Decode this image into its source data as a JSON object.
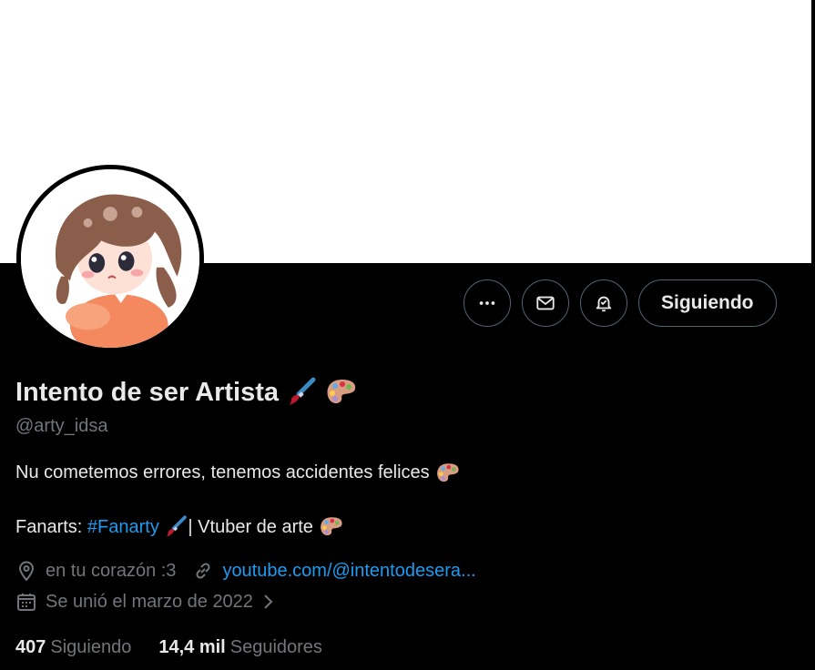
{
  "profile": {
    "display_name": "Intento de ser Artista",
    "handle": "@arty_idsa",
    "bio_line1": "Nu cometemos errores, tenemos accidentes felices",
    "bio_line2_prefix": "Fanarts: ",
    "bio_line2_hashtag": "#Fanarty",
    "bio_line2_suffix": "| Vtuber de arte",
    "location": "en tu corazón :3",
    "website": "youtube.com/@intentodesera...",
    "joined": "Se unió el marzo de 2022"
  },
  "actions": {
    "follow_label": "Siguiendo",
    "more_icon": "more-icon",
    "message_icon": "mail-icon",
    "notify_icon": "bell-check-icon"
  },
  "stats": {
    "following_count": "407",
    "following_label": "Siguiendo",
    "followers_count": "14,4 mil",
    "followers_label": "Seguidores"
  },
  "colors": {
    "background": "#000000",
    "banner": "#ffffff",
    "link": "#1d9bf0",
    "muted": "#71767b",
    "text": "#e7e9ea"
  }
}
